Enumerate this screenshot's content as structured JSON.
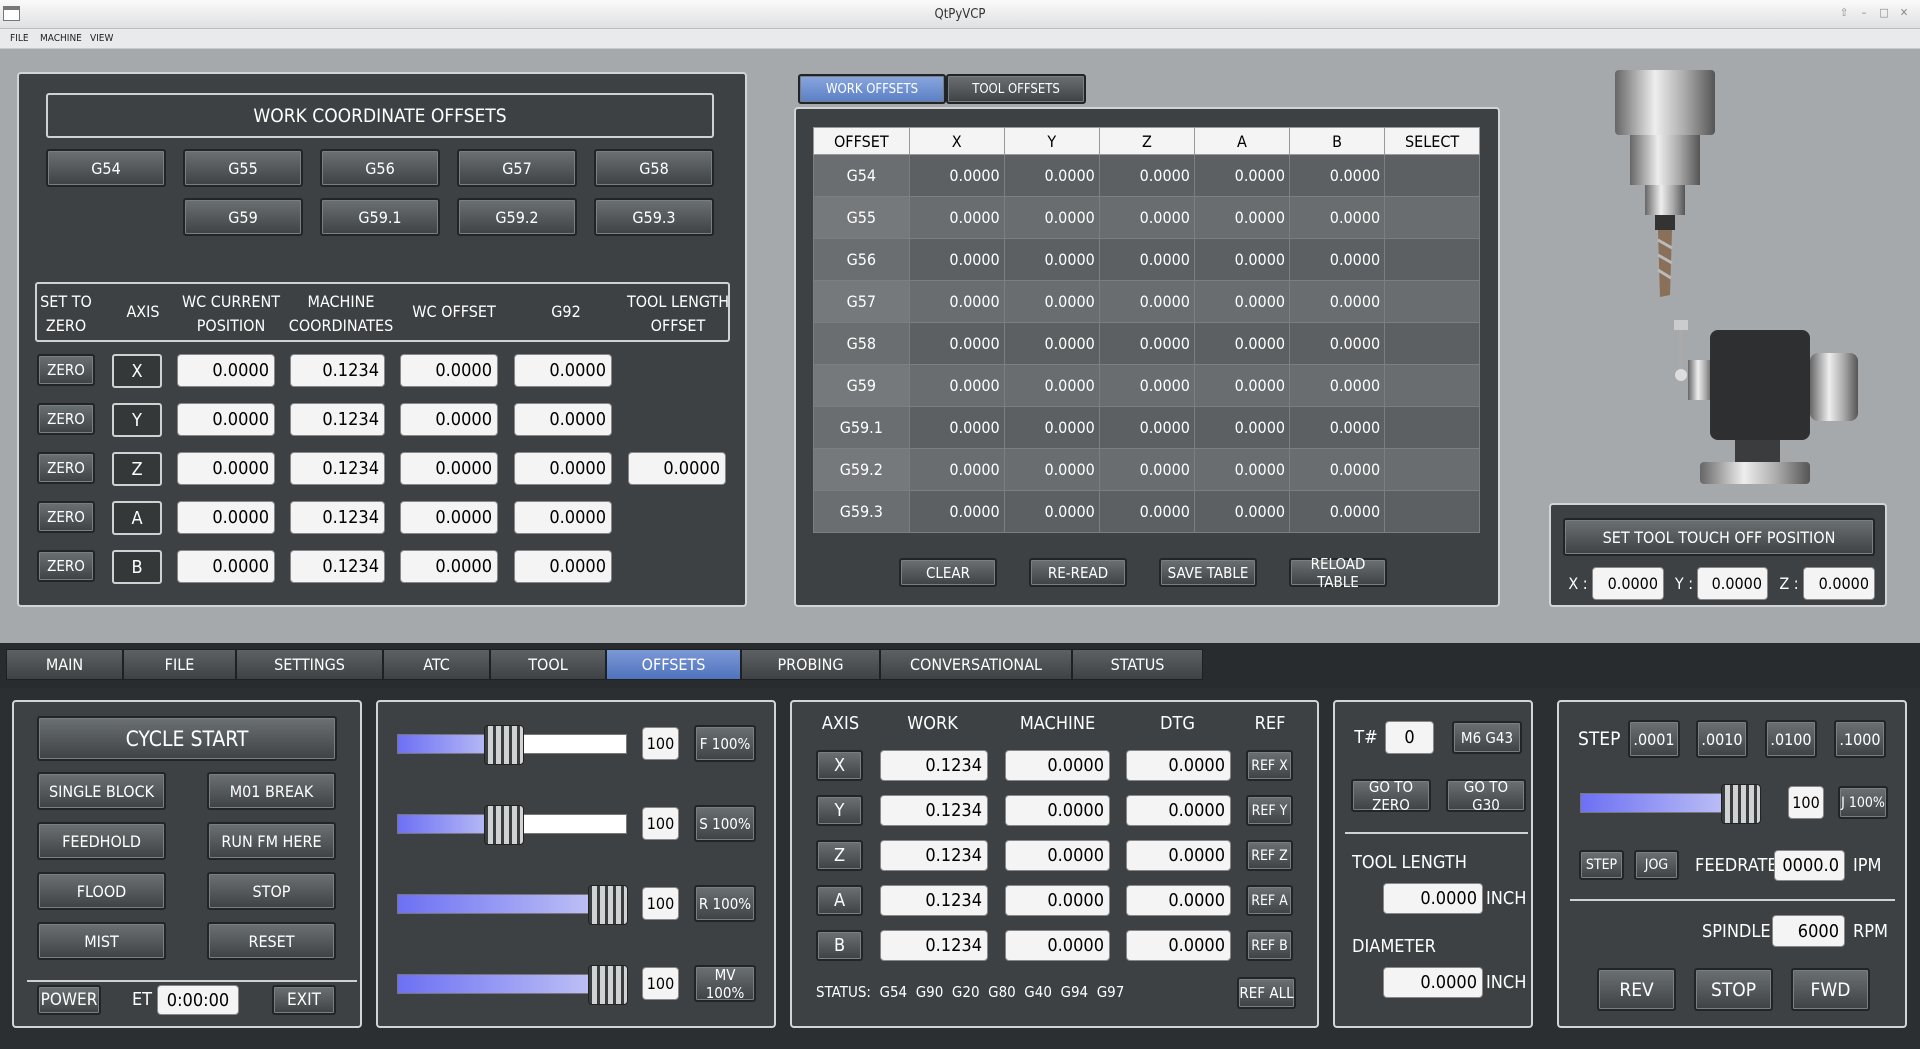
{
  "window": {
    "title": "QtPyVCP"
  },
  "menu": [
    "FILE",
    "MACHINE",
    "VIEW"
  ],
  "wco": {
    "title": "WORK COORDINATE OFFSETS",
    "row1": [
      "G54",
      "G55",
      "G56",
      "G57",
      "G58"
    ],
    "row2": [
      "G59",
      "G59.1",
      "G59.2",
      "G59.3"
    ],
    "headers": {
      "zero": "SET TO\nZERO",
      "axis": "AXIS",
      "wc": "WC CURRENT\nPOSITION",
      "mach": "MACHINE\nCOORDINATES",
      "off": "WC OFFSET",
      "g92": "G92",
      "tlo": "TOOL LENGTH\nOFFSET"
    },
    "zero_label": "ZERO",
    "rows": [
      {
        "axis": "X",
        "wc": "0.0000",
        "mach": "0.1234",
        "off": "0.0000",
        "g92": "0.0000"
      },
      {
        "axis": "Y",
        "wc": "0.0000",
        "mach": "0.1234",
        "off": "0.0000",
        "g92": "0.0000"
      },
      {
        "axis": "Z",
        "wc": "0.0000",
        "mach": "0.1234",
        "off": "0.0000",
        "g92": "0.0000",
        "tlo": "0.0000"
      },
      {
        "axis": "A",
        "wc": "0.0000",
        "mach": "0.1234",
        "off": "0.0000",
        "g92": "0.0000"
      },
      {
        "axis": "B",
        "wc": "0.0000",
        "mach": "0.1234",
        "off": "0.0000",
        "g92": "0.0000"
      }
    ]
  },
  "offsets_tabs": [
    "WORK OFFSETS",
    "TOOL OFFSETS"
  ],
  "offset_table": {
    "headers": [
      "OFFSET",
      "X",
      "Y",
      "Z",
      "A",
      "B",
      "SELECT"
    ],
    "rows": [
      [
        "G54",
        "0.0000",
        "0.0000",
        "0.0000",
        "0.0000",
        "0.0000"
      ],
      [
        "G55",
        "0.0000",
        "0.0000",
        "0.0000",
        "0.0000",
        "0.0000"
      ],
      [
        "G56",
        "0.0000",
        "0.0000",
        "0.0000",
        "0.0000",
        "0.0000"
      ],
      [
        "G57",
        "0.0000",
        "0.0000",
        "0.0000",
        "0.0000",
        "0.0000"
      ],
      [
        "G58",
        "0.0000",
        "0.0000",
        "0.0000",
        "0.0000",
        "0.0000"
      ],
      [
        "G59",
        "0.0000",
        "0.0000",
        "0.0000",
        "0.0000",
        "0.0000"
      ],
      [
        "G59.1",
        "0.0000",
        "0.0000",
        "0.0000",
        "0.0000",
        "0.0000"
      ],
      [
        "G59.2",
        "0.0000",
        "0.0000",
        "0.0000",
        "0.0000",
        "0.0000"
      ],
      [
        "G59.3",
        "0.0000",
        "0.0000",
        "0.0000",
        "0.0000",
        "0.0000"
      ]
    ],
    "buttons": [
      "CLEAR",
      "RE-READ",
      "SAVE TABLE",
      "RELOAD TABLE"
    ]
  },
  "touchoff": {
    "button": "SET TOOL TOUCH OFF POSITION",
    "x_label": "X :",
    "y_label": "Y :",
    "z_label": "Z :",
    "x": "0.0000",
    "y": "0.0000",
    "z": "0.0000"
  },
  "main_tabs": [
    "MAIN",
    "FILE",
    "SETTINGS",
    "ATC",
    "TOOL",
    "OFFSETS",
    "PROBING",
    "CONVERSATIONAL",
    "STATUS"
  ],
  "active_tab": "OFFSETS",
  "control": {
    "cycle_start": "CYCLE START",
    "single_block": "SINGLE BLOCK",
    "m01": "M01 BREAK",
    "feedhold": "FEEDHOLD",
    "run_here": "RUN FM HERE",
    "flood": "FLOOD",
    "stop": "STOP",
    "mist": "MIST",
    "reset": "RESET",
    "power": "POWER",
    "et_label": "ET",
    "et_value": "0:00:00",
    "exit": "EXIT"
  },
  "overrides": [
    {
      "value": "100",
      "button": "F 100%",
      "level": 0.45
    },
    {
      "value": "100",
      "button": "S 100%",
      "level": 0.45
    },
    {
      "value": "100",
      "button": "R 100%",
      "level": 1.0
    },
    {
      "value": "100",
      "button": "MV 100%",
      "level": 1.0
    }
  ],
  "dro": {
    "headers": [
      "AXIS",
      "WORK",
      "MACHINE",
      "DTG",
      "REF"
    ],
    "rows": [
      {
        "axis": "X",
        "work": "0.1234",
        "mach": "0.0000",
        "dtg": "0.0000",
        "ref": "REF X"
      },
      {
        "axis": "Y",
        "work": "0.1234",
        "mach": "0.0000",
        "dtg": "0.0000",
        "ref": "REF Y"
      },
      {
        "axis": "Z",
        "work": "0.1234",
        "mach": "0.0000",
        "dtg": "0.0000",
        "ref": "REF Z"
      },
      {
        "axis": "A",
        "work": "0.1234",
        "mach": "0.0000",
        "dtg": "0.0000",
        "ref": "REF A"
      },
      {
        "axis": "B",
        "work": "0.1234",
        "mach": "0.0000",
        "dtg": "0.0000",
        "ref": "REF B"
      }
    ],
    "status": "STATUS:  G54  G90  G20  G80  G40  G94  G97",
    "ref_all": "REF ALL"
  },
  "tool": {
    "t_label": "T#",
    "t_value": "0",
    "m6": "M6 G43",
    "go_zero": "GO TO ZERO",
    "go_g30": "GO TO G30",
    "length_label": "TOOL LENGTH",
    "length": "0.0000",
    "length_unit": "INCH",
    "diam_label": "DIAMETER",
    "diam": "0.0000",
    "diam_unit": "INCH"
  },
  "jog": {
    "step_label": "STEP",
    "steps": [
      ".0001",
      ".0010",
      ".0100",
      ".1000"
    ],
    "value": "100",
    "j_button": "J 100%",
    "level": 1.0,
    "step_btn": "STEP",
    "jog_btn": "JOG",
    "feed_label": "FEEDRATE",
    "feed": "0000.0",
    "feed_unit": "IPM",
    "spindle_label": "SPINDLE",
    "spindle": "6000",
    "spindle_unit": "RPM",
    "rev": "REV",
    "stop": "STOP",
    "fwd": "FWD"
  }
}
